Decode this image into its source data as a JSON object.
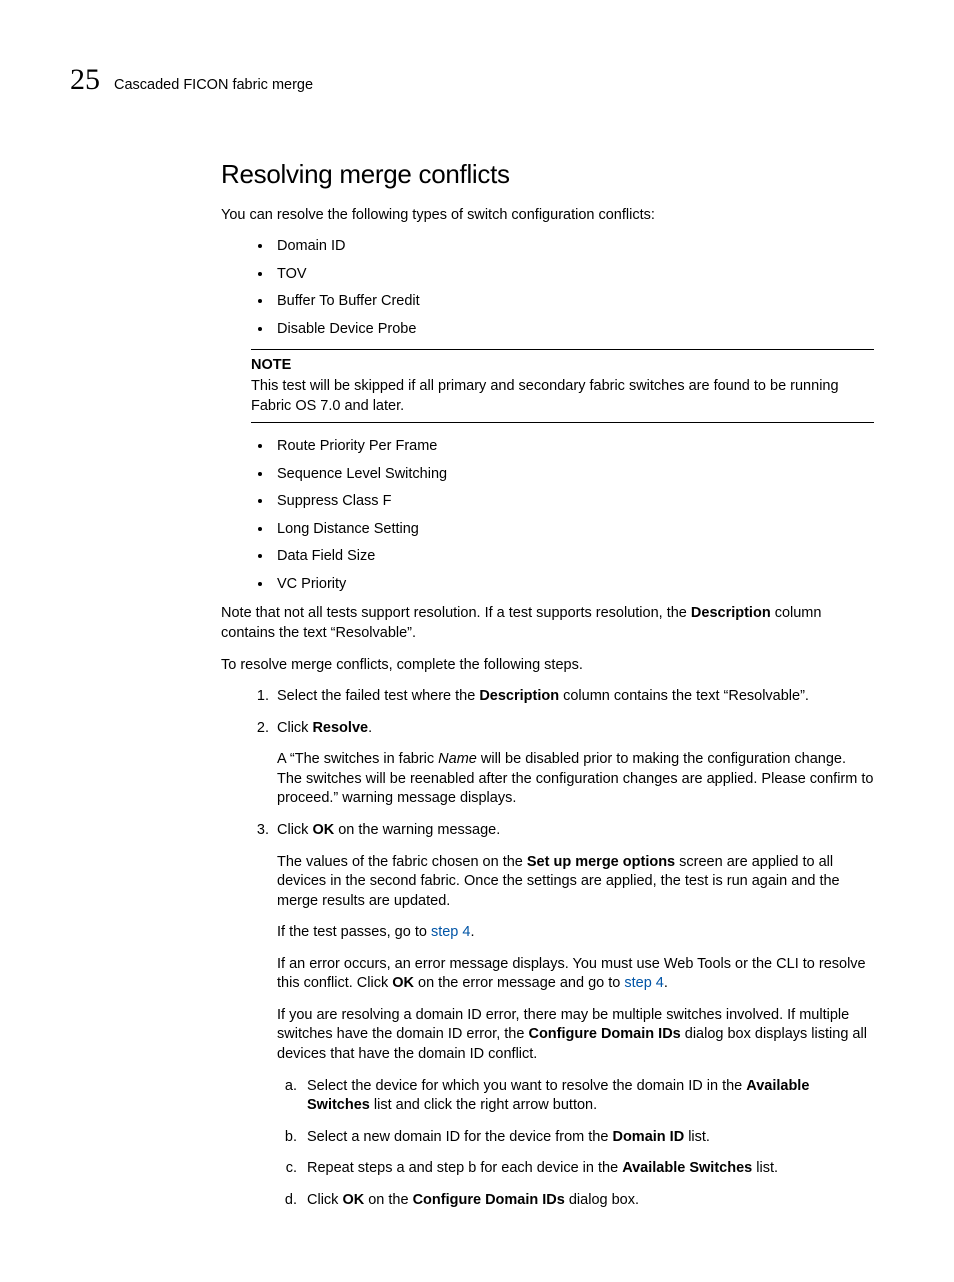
{
  "header": {
    "chapter_number": "25",
    "chapter_title": "Cascaded FICON fabric merge"
  },
  "section_heading": "Resolving merge conflicts",
  "intro": "You can resolve the following types of switch configuration conflicts:",
  "bullets_a": [
    "Domain ID",
    "TOV",
    "Buffer To Buffer Credit",
    "Disable Device Probe"
  ],
  "note": {
    "heading": "NOTE",
    "text": "This test will be skipped if all primary and secondary fabric switches are found to be running Fabric OS 7.0 and later."
  },
  "bullets_b": [
    "Route Priority Per Frame",
    "Sequence Level Switching",
    "Suppress Class F",
    "Long Distance Setting",
    "Data Field Size",
    "VC Priority"
  ],
  "para_note": {
    "pre": "Note that not all tests support resolution. If a test supports resolution, the ",
    "bold": "Description",
    "post": " column contains the text “Resolvable”."
  },
  "para_lead": "To resolve merge conflicts, complete the following steps.",
  "steps": {
    "s1": {
      "pre": "Select the failed test where the ",
      "bold": "Description",
      "post": " column contains the text “Resolvable”."
    },
    "s2": {
      "pre": "Click ",
      "bold": "Resolve",
      "post": ".",
      "p1_pre": "A “The switches in fabric ",
      "p1_italic": "Name",
      "p1_post": " will be disabled prior to making the configuration change. The switches will be reenabled after the configuration changes are applied. Please confirm to proceed.” warning message displays."
    },
    "s3": {
      "pre": "Click ",
      "bold": "OK",
      "post": " on the warning message.",
      "p1_pre": "The values of the fabric chosen on the ",
      "p1_bold": "Set up merge options",
      "p1_post": " screen are applied to all devices in the second fabric. Once the settings are applied, the test is run again and the merge results are updated.",
      "p2_pre": "If the test passes, go to ",
      "p2_link": "step 4",
      "p2_post": ".",
      "p3_pre": "If an error occurs, an error message displays. You must use Web Tools or the CLI to resolve this conflict. Click ",
      "p3_bold": "OK",
      "p3_mid": " on the error message and go to ",
      "p3_link": "step 4",
      "p3_post": ".",
      "p4_pre": "If you are resolving a domain ID error, there may be multiple switches involved. If multiple switches have the domain ID error, the ",
      "p4_bold": "Configure Domain IDs",
      "p4_post": " dialog box displays listing all devices that have the domain ID conflict.",
      "sub": {
        "a_pre": "Select the device for which you want to resolve the domain ID in the ",
        "a_bold": "Available Switches",
        "a_post": " list and click the right arrow button.",
        "b_pre": "Select a new domain ID for the device from the ",
        "b_bold": "Domain ID",
        "b_post": " list.",
        "c_pre": "Repeat steps a and step b for each device in the ",
        "c_bold": "Available Switches",
        "c_post": " list.",
        "d_pre": "Click ",
        "d_bold1": "OK",
        "d_mid": " on the ",
        "d_bold2": "Configure Domain IDs",
        "d_post": " dialog box."
      }
    }
  }
}
